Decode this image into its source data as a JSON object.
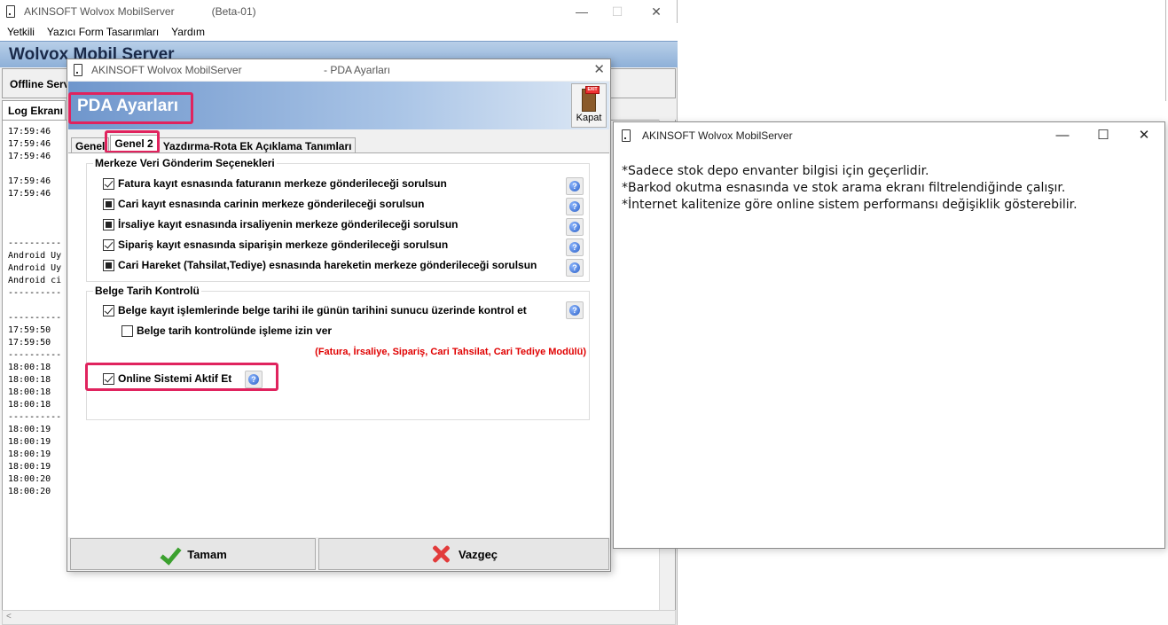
{
  "main_window": {
    "title": "AKINSOFT Wolvox MobilServer",
    "beta": "(Beta-01)",
    "controls": {
      "minimize": "—",
      "maximize": "☐",
      "close": "✕"
    },
    "menu": [
      "Yetkili",
      "Yazıcı Form Tasarımları",
      "Yardım"
    ],
    "banner_title": "Wolvox Mobil Server",
    "offline_label": "Offline Serv",
    "log_tab": "Log Ekranı",
    "log_lines": "17:59:46\n17:59:46\n17:59:46\n\n17:59:46\n17:59:46\n\n\n\n----------\nAndroid Uy\nAndroid Uy\nAndroid ci\n----------\n\n----------\n17:59:50\n17:59:50\n----------\n18:00:18\n18:00:18\n18:00:18\n18:00:18\n----------\n18:00:19\n18:00:19\n18:00:19\n18:00:19\n18:00:20\n18:00:20"
  },
  "pda_dialog": {
    "title": "AKINSOFT Wolvox MobilServer",
    "title_suffix": "- PDA Ayarları",
    "close": "✕",
    "header_title": "PDA Ayarları",
    "kapat_label": "Kapat",
    "kapat_sign": "EXIT",
    "tabs": [
      "Genel",
      "Genel 2",
      "Yazdırma-Rota Ek Açıklama Tanımları"
    ],
    "group1": {
      "title": "Merkeze Veri Gönderim Seçenekleri",
      "options": [
        {
          "label": "Fatura kayıt esnasında faturanın merkeze gönderileceği sorulsun",
          "state": "checked"
        },
        {
          "label": "Cari kayıt esnasında carinin merkeze gönderileceği sorulsun",
          "state": "indeterminate"
        },
        {
          "label": "İrsaliye kayıt esnasında irsaliyenin merkeze gönderileceği sorulsun",
          "state": "indeterminate"
        },
        {
          "label": "Sipariş kayıt esnasında siparişin merkeze gönderileceği sorulsun",
          "state": "checked"
        },
        {
          "label": "Cari Hareket (Tahsilat,Tediye) esnasında hareketin merkeze gönderileceği sorulsun",
          "state": "indeterminate"
        }
      ]
    },
    "group2": {
      "title": "Belge Tarih Kontrolü",
      "option_main": {
        "label": "Belge kayıt işlemlerinde belge tarihi ile günün tarihini sunucu üzerinde kontrol et",
        "state": "checked"
      },
      "option_sub": {
        "label": "Belge tarih kontrolünde işleme izin ver",
        "state": "unchecked"
      },
      "note": "(Fatura, İrsaliye, Sipariş, Cari Tahsilat, Cari Tediye Modülü)"
    },
    "online_option": {
      "label": "Online Sistemi Aktif Et",
      "state": "checked"
    },
    "buttons": {
      "ok": "Tamam",
      "cancel": "Vazgeç"
    },
    "highlight_color": "#e0235e"
  },
  "info_window": {
    "title": "AKINSOFT Wolvox MobilServer",
    "controls": {
      "minimize": "—",
      "maximize": "☐",
      "close": "✕"
    },
    "lines": [
      "*Sadece stok depo envanter bilgisi için geçerlidir.",
      "*Barkod okutma esnasında ve stok arama ekranı filtrelendiğinde çalışır.",
      "*İnternet kalitenize göre online sistem performansı değişiklik gösterebilir."
    ]
  }
}
